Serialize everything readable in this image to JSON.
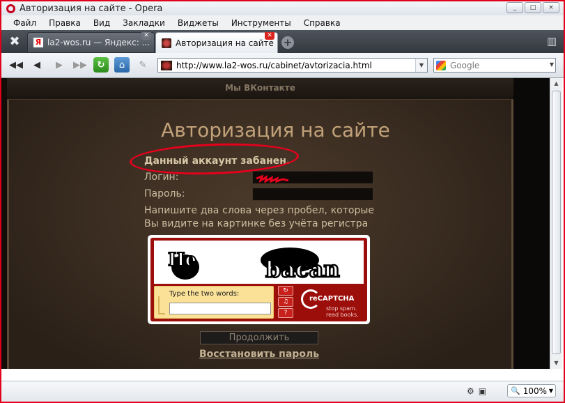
{
  "window": {
    "title": "Авторизация на сайте - Opera",
    "controls": [
      "_",
      "□",
      "×"
    ]
  },
  "menu": [
    "Файл",
    "Правка",
    "Вид",
    "Закладки",
    "Виджеты",
    "Инструменты",
    "Справка"
  ],
  "tabs": [
    {
      "label": "la2-wos.ru — Яндекс: ...",
      "favicon": "Я",
      "active": false
    },
    {
      "label": "Авторизация на сайте",
      "active": true
    }
  ],
  "address": {
    "url": "http://www.la2-wos.ru/cabinet/avtorizacia.html"
  },
  "search": {
    "placeholder": "Google"
  },
  "page": {
    "top_link": "Мы ВКонтакте",
    "title": "Авторизация на сайте",
    "error": "Данный аккаунт забанен.",
    "login_label": "Логин:",
    "password_label": "Пароль:",
    "instruction": "Напишите два слова через пробел, которые Вы видите на картинке без учёта регистра",
    "captcha": {
      "word1": "He",
      "word2": "bacan",
      "prompt": "Type the two words:",
      "brand": "reCAPTCHA",
      "tagline1": "stop spam.",
      "tagline2": "read books."
    },
    "submit": "Продолжить",
    "restore": "Восстановить пароль"
  },
  "status": {
    "zoom": "100%"
  },
  "colors": {
    "annotation": "#e6001c",
    "title": "#c2a27a",
    "captcha_red": "#9b0e0a"
  }
}
